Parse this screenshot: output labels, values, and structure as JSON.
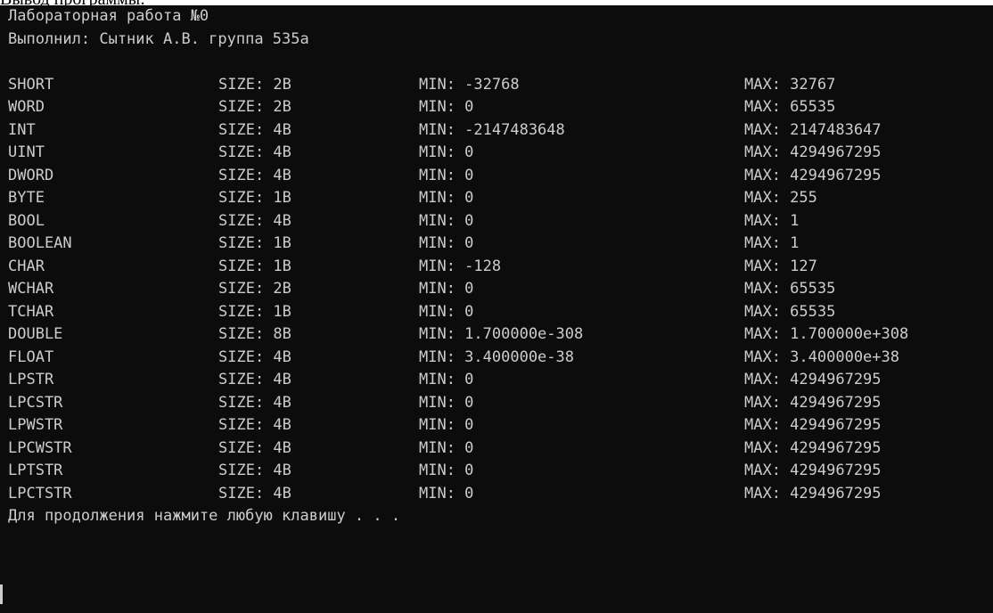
{
  "document": {
    "top_text": "Вывод программы:"
  },
  "console": {
    "header_line1": "Лабораторная работа №0",
    "header_line2": "Выполнил: Сытник А.В. группа 535а",
    "rows": [
      {
        "name": "SHORT",
        "size": "SIZE: 2B",
        "min": "MIN: -32768",
        "max": "MAX: 32767"
      },
      {
        "name": "WORD",
        "size": "SIZE: 2B",
        "min": "MIN: 0",
        "max": "MAX: 65535"
      },
      {
        "name": "INT",
        "size": "SIZE: 4B",
        "min": "MIN: -2147483648",
        "max": "MAX: 2147483647"
      },
      {
        "name": "UINT",
        "size": "SIZE: 4B",
        "min": "MIN: 0",
        "max": "MAX: 4294967295"
      },
      {
        "name": "DWORD",
        "size": "SIZE: 4B",
        "min": "MIN: 0",
        "max": "MAX: 4294967295"
      },
      {
        "name": "BYTE",
        "size": "SIZE: 1B",
        "min": "MIN: 0",
        "max": "MAX: 255"
      },
      {
        "name": "BOOL",
        "size": "SIZE: 4B",
        "min": "MIN: 0",
        "max": "MAX: 1"
      },
      {
        "name": "BOOLEAN",
        "size": "SIZE: 1B",
        "min": "MIN: 0",
        "max": "MAX: 1"
      },
      {
        "name": "CHAR",
        "size": "SIZE: 1B",
        "min": "MIN: -128",
        "max": "MAX: 127"
      },
      {
        "name": "WCHAR",
        "size": "SIZE: 2B",
        "min": "MIN: 0",
        "max": "MAX: 65535"
      },
      {
        "name": "TCHAR",
        "size": "SIZE: 1B",
        "min": "MIN: 0",
        "max": "MAX: 65535"
      },
      {
        "name": "DOUBLE",
        "size": "SIZE: 8B",
        "min": "MIN: 1.700000e-308",
        "max": "MAX: 1.700000e+308"
      },
      {
        "name": "FLOAT",
        "size": "SIZE: 4B",
        "min": "MIN: 3.400000e-38",
        "max": "MAX: 3.400000e+38"
      },
      {
        "name": "LPSTR",
        "size": "SIZE: 4B",
        "min": "MIN: 0",
        "max": "MAX: 4294967295"
      },
      {
        "name": "LPCSTR",
        "size": "SIZE: 4B",
        "min": "MIN: 0",
        "max": "MAX: 4294967295"
      },
      {
        "name": "LPWSTR",
        "size": "SIZE: 4B",
        "min": "MIN: 0",
        "max": "MAX: 4294967295"
      },
      {
        "name": "LPCWSTR",
        "size": "SIZE: 4B",
        "min": "MIN: 0",
        "max": "MAX: 4294967295"
      },
      {
        "name": "LPTSTR",
        "size": "SIZE: 4B",
        "min": "MIN: 0",
        "max": "MAX: 4294967295"
      },
      {
        "name": "LPCTSTR",
        "size": "SIZE: 4B",
        "min": "MIN: 0",
        "max": "MAX: 4294967295"
      }
    ],
    "footer": "Для продолжения нажмите любую клавишу . . ."
  },
  "colors": {
    "console_bg": "#0c0c0c",
    "console_fg": "#cccccc",
    "page_bg": "#ffffff"
  }
}
